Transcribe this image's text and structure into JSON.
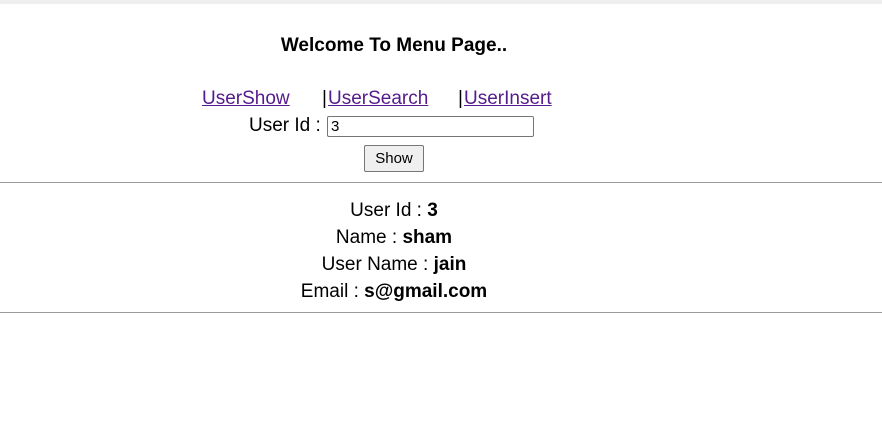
{
  "header": {
    "title": "Welcome To Menu Page.."
  },
  "menu": {
    "items": [
      {
        "label": "UserShow"
      },
      {
        "label": "UserSearch"
      },
      {
        "label": "UserInsert"
      }
    ],
    "separator": "|",
    "link_color": "#551a8b"
  },
  "search_form": {
    "user_id_label": "User Id :",
    "user_id_value": "3",
    "submit_label": "Show"
  },
  "user_details": {
    "user_id_label": "User Id :",
    "user_id_value": "3",
    "name_label": "Name :",
    "name_value": "sham",
    "username_label": "User Name :",
    "username_value": "jain",
    "email_label": "Email :",
    "email_value": "s@gmail.com"
  }
}
